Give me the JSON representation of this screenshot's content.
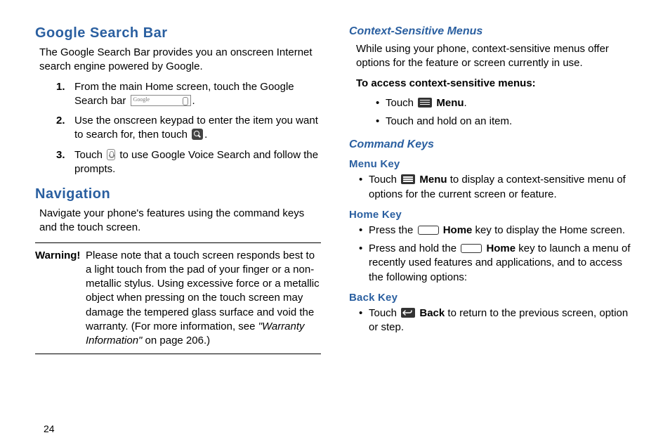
{
  "page_number": "24",
  "left": {
    "h_google": "Google Search Bar",
    "google_intro": "The Google Search Bar provides you an onscreen Internet search engine powered by Google.",
    "steps": {
      "s1a": "From the main Home screen, touch the Google Search bar ",
      "s1b": ".",
      "s2a": "Use the onscreen keypad to enter the item you want to search for, then touch ",
      "s2b": ".",
      "s3a": "Touch ",
      "s3b": " to use Google Voice Search and follow the prompts."
    },
    "h_nav": "Navigation",
    "nav_intro": "Navigate your phone's features using the command keys and the touch screen.",
    "warn_label": "Warning!",
    "warn_a": "Please note that a touch screen responds best to a light touch from the pad of your finger or a non-metallic stylus. Using excessive force or a metallic object when pressing on the touch screen may damage the tempered glass surface and void the warranty. (For more information, see ",
    "warn_ref": "\"Warranty Information\"",
    "warn_b": " on page 206.)"
  },
  "right": {
    "h_context": "Context-Sensitive Menus",
    "context_intro": "While using your phone, context-sensitive menus offer options for the feature or screen currently in use.",
    "context_access": "To access context-sensitive menus:",
    "ctx_b1a": "Touch ",
    "ctx_b1_menu": "Menu",
    "ctx_b1b": ".",
    "ctx_b2": "Touch and hold on an item.",
    "h_command": "Command Keys",
    "h_menu": "Menu Key",
    "menu_b1a": "Touch ",
    "menu_b1_menu": "Menu",
    "menu_b1b": " to display a context-sensitive menu of options for the current screen or feature.",
    "h_home": "Home Key",
    "home_b1a": "Press the ",
    "home_b1_home": "Home",
    "home_b1b": " key to display the Home screen.",
    "home_b2a": "Press and hold the ",
    "home_b2_home": "Home",
    "home_b2b": " key to launch a menu of recently used features and applications, and to access the following options:",
    "h_back": "Back Key",
    "back_b1a": "Touch ",
    "back_b1_back": "Back",
    "back_b1b": " to return to the previous screen, option or step."
  }
}
